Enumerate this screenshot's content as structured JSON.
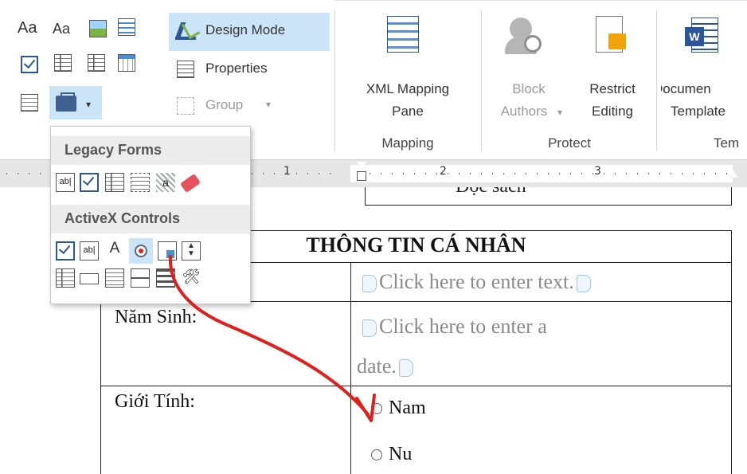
{
  "ribbon": {
    "design_mode_label": "Design Mode",
    "properties_label": "Properties",
    "group_label": "Group",
    "font_icon_aa1": "Aa",
    "font_icon_aa2": "Aa",
    "xml_mapping_line1": "XML Mapping",
    "xml_mapping_line2": "Pane",
    "block_authors_line1": "Block",
    "block_authors_line2": "Authors",
    "restrict_editing_line1": "Restrict",
    "restrict_editing_line2": "Editing",
    "document_template_line1": "Documen",
    "document_template_line2": "Template",
    "group_labels": {
      "mapping": "Mapping",
      "protect": "Protect",
      "templates": "Tem"
    }
  },
  "ruler": {
    "numbers": [
      "1",
      "2",
      "3"
    ]
  },
  "popup": {
    "legacy_forms_header": "Legacy Forms",
    "activex_header": "ActiveX Controls",
    "legacy_abl": "ab|",
    "activex_abl": "ab|",
    "activex_label_a": "A"
  },
  "document": {
    "header_partial": "Đọc sách",
    "table_title": "THÔNG TIN CÁ NHÂN",
    "row1_placeholder": "Click here to enter text.",
    "row2_label": "Năm Sinh:",
    "row2_placeholder_line1": "Click here to enter a",
    "row2_placeholder_line2": "date.",
    "row3_label": "Giới Tính:",
    "radio_options": [
      "Nam",
      "Nu"
    ]
  },
  "colors": {
    "accent_blue": "#2b579a",
    "highlight": "#cce4f7",
    "arrow_red": "#e0201c",
    "word_blue": "#2b579a"
  }
}
